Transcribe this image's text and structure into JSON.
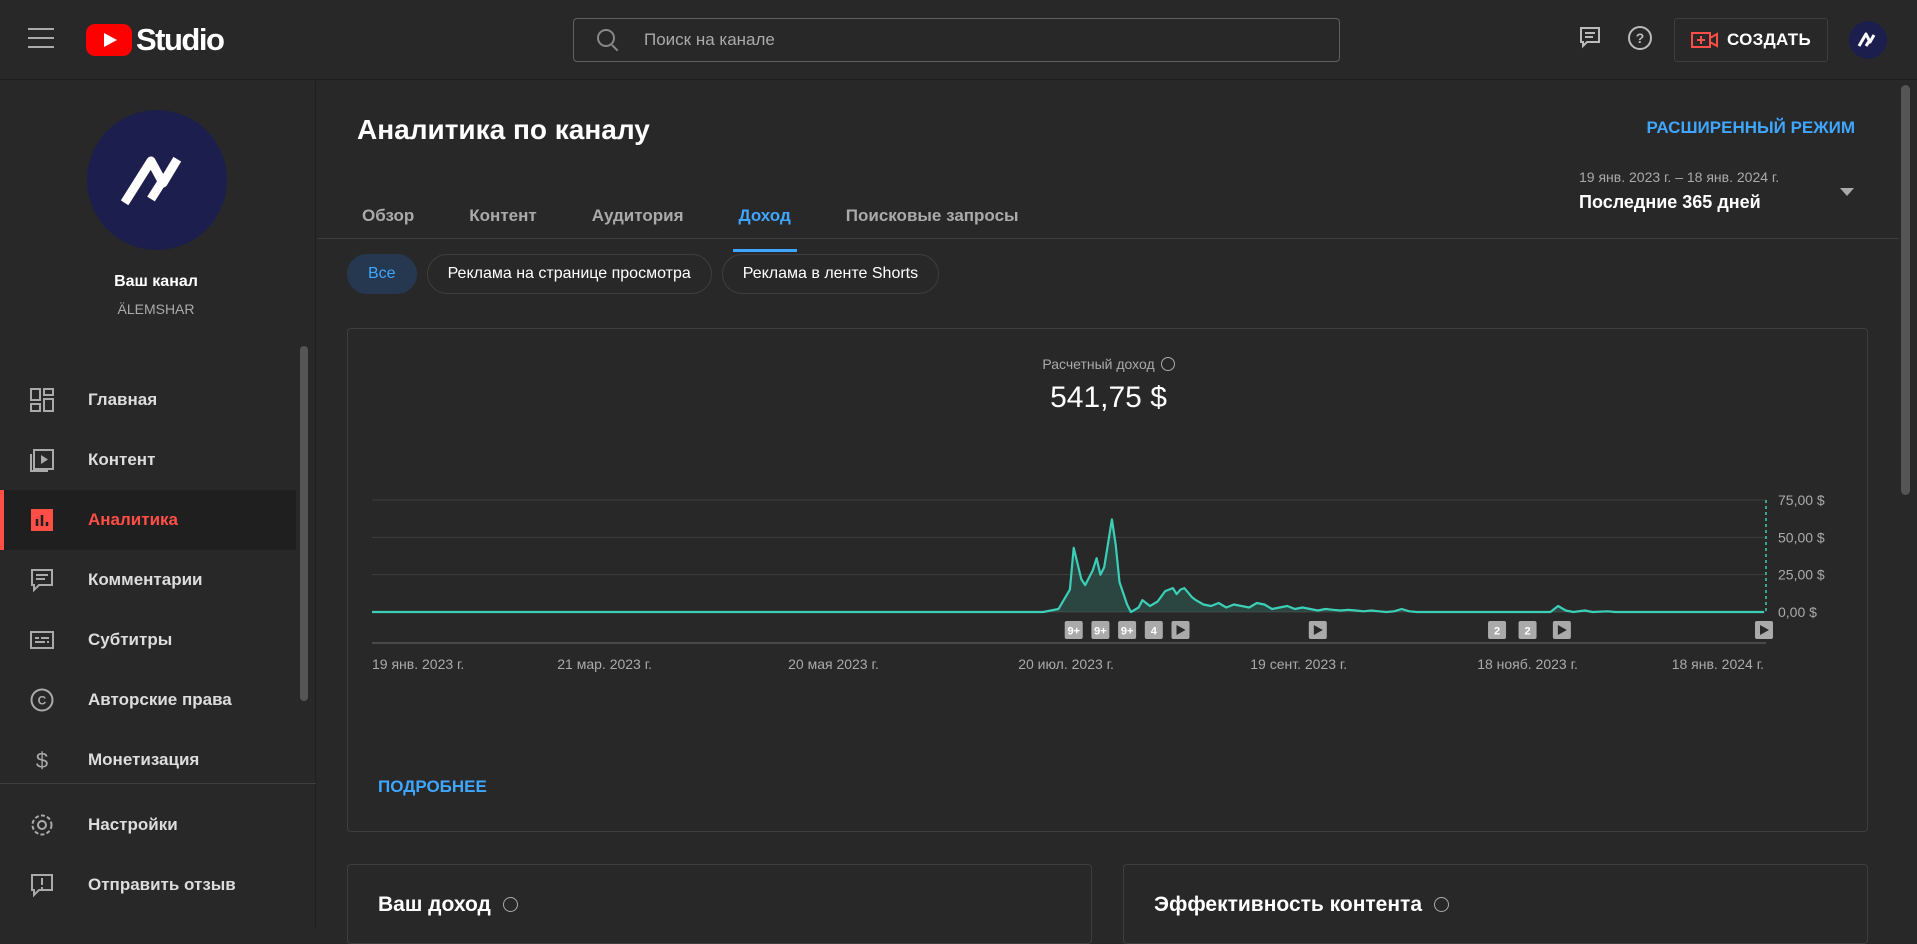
{
  "header": {
    "logo_text": "Studio",
    "search_placeholder": "Поиск на канале",
    "create_label": "СОЗДАТЬ"
  },
  "sidebar": {
    "channel_title": "Ваш канал",
    "channel_handle": "ÄLEMSHAR",
    "items": [
      {
        "label": "Главная",
        "icon": "dashboard-icon"
      },
      {
        "label": "Контент",
        "icon": "content-icon"
      },
      {
        "label": "Аналитика",
        "icon": "analytics-icon",
        "active": true
      },
      {
        "label": "Комментарии",
        "icon": "comments-icon"
      },
      {
        "label": "Субтитры",
        "icon": "subtitles-icon"
      },
      {
        "label": "Авторские права",
        "icon": "copyright-icon"
      },
      {
        "label": "Монетизация",
        "icon": "dollar-icon"
      }
    ],
    "bottom_items": [
      {
        "label": "Настройки",
        "icon": "gear-icon"
      },
      {
        "label": "Отправить отзыв",
        "icon": "feedback-icon"
      }
    ]
  },
  "main": {
    "title": "Аналитика по каналу",
    "advanced_mode": "РАСШИРЕННЫЙ РЕЖИМ",
    "date_range": "19 янв. 2023 г. – 18 янв. 2024 г.",
    "date_label": "Последние 365 дней",
    "tabs": [
      "Обзор",
      "Контент",
      "Аудитория",
      "Доход",
      "Поисковые запросы"
    ],
    "active_tab": "Доход",
    "chips": [
      "Все",
      "Реклама на странице просмотра",
      "Реклама в ленте Shorts"
    ],
    "metric_label": "Расчетный доход",
    "metric_value": "541,75 $",
    "more_link": "ПОДРОБНЕЕ",
    "card_your_revenue": "Ваш доход",
    "card_content_perf": "Эффективность контента"
  },
  "colors": {
    "accent": "#3ea6ff",
    "active_nav": "#ff4e45",
    "line": "#3ccfb8",
    "brand_red": "#ff0000"
  },
  "chart_data": {
    "type": "line",
    "x_ticks": [
      "19 янв. 2023 г.",
      "21 мар. 2023 г.",
      "20 мая 2023 г.",
      "20 июл. 2023 г.",
      "19 сент. 2023 г.",
      "18 нояб. 2023 г.",
      "18 янв. 2024 г."
    ],
    "y_ticks": [
      "75,00 $",
      "50,00 $",
      "25,00 $",
      "0,00 $"
    ],
    "ylim": [
      0,
      75
    ],
    "x_start_label": "19 янв. 2023 г.",
    "x_end_label": "18 янв. 2024 г.",
    "series": [
      {
        "values": [
          [
            0,
            0
          ],
          [
            176,
            0
          ],
          [
            180,
            2
          ],
          [
            183,
            15
          ],
          [
            184,
            43
          ],
          [
            186,
            22
          ],
          [
            187,
            18
          ],
          [
            189,
            28
          ],
          [
            190,
            36
          ],
          [
            191,
            25
          ],
          [
            192,
            30
          ],
          [
            194,
            62
          ],
          [
            195,
            45
          ],
          [
            196,
            20
          ],
          [
            198,
            5
          ],
          [
            199,
            0
          ],
          [
            201,
            3
          ],
          [
            202,
            8
          ],
          [
            204,
            4
          ],
          [
            206,
            7
          ],
          [
            208,
            14
          ],
          [
            210,
            16
          ],
          [
            211,
            12
          ],
          [
            212,
            15
          ],
          [
            213,
            16
          ],
          [
            215,
            10
          ],
          [
            216,
            8
          ],
          [
            218,
            5
          ],
          [
            220,
            4
          ],
          [
            222,
            6
          ],
          [
            224,
            3
          ],
          [
            226,
            5
          ],
          [
            228,
            4
          ],
          [
            230,
            3
          ],
          [
            232,
            6
          ],
          [
            234,
            5
          ],
          [
            236,
            2
          ],
          [
            238,
            3
          ],
          [
            240,
            4
          ],
          [
            242,
            2
          ],
          [
            244,
            3
          ],
          [
            246,
            2
          ],
          [
            248,
            1
          ],
          [
            250,
            2
          ],
          [
            252,
            1.5
          ],
          [
            254,
            1
          ],
          [
            256,
            1.5
          ],
          [
            258,
            1
          ],
          [
            260,
            0.5
          ],
          [
            262,
            1
          ],
          [
            264,
            0.5
          ],
          [
            266,
            0
          ],
          [
            268,
            0.5
          ],
          [
            270,
            2
          ],
          [
            272,
            0.5
          ],
          [
            274,
            0
          ],
          [
            300,
            0
          ],
          [
            309,
            0
          ],
          [
            311,
            4
          ],
          [
            313,
            1
          ],
          [
            315,
            0
          ],
          [
            318,
            1
          ],
          [
            320,
            0
          ],
          [
            324,
            0.5
          ],
          [
            326,
            0
          ],
          [
            365,
            0
          ]
        ]
      }
    ],
    "x_range_days": [
      0,
      365
    ],
    "markers": [
      {
        "day": 184,
        "label": "9+"
      },
      {
        "day": 191,
        "label": "9+"
      },
      {
        "day": 198,
        "label": "9+"
      },
      {
        "day": 205,
        "label": "4"
      },
      {
        "day": 212,
        "label": "play"
      },
      {
        "day": 248,
        "label": "play"
      },
      {
        "day": 295,
        "label": "2"
      },
      {
        "day": 303,
        "label": "2"
      },
      {
        "day": 312,
        "label": "play"
      },
      {
        "day": 365,
        "label": "play"
      }
    ]
  }
}
